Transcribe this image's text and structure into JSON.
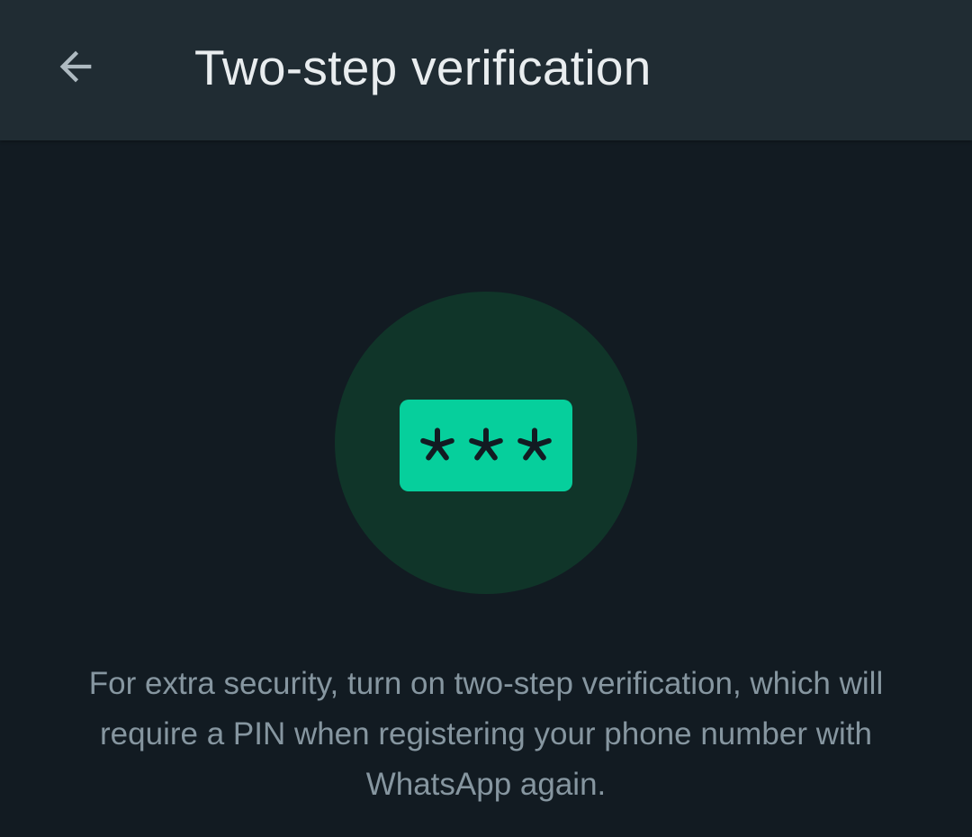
{
  "header": {
    "title": "Two-step verification",
    "back_icon": "arrow-left-icon"
  },
  "illustration": {
    "icon": "pin-asterisks-icon",
    "circle_color": "#103529",
    "accent_color": "#06cf9c"
  },
  "main": {
    "description": "For extra security, turn on two-step verification, which will require a PIN when registering your phone number with WhatsApp again."
  },
  "colors": {
    "background": "#121b22",
    "app_bar": "#202c33",
    "title_text": "#e9edef",
    "body_text": "#8696a0"
  }
}
